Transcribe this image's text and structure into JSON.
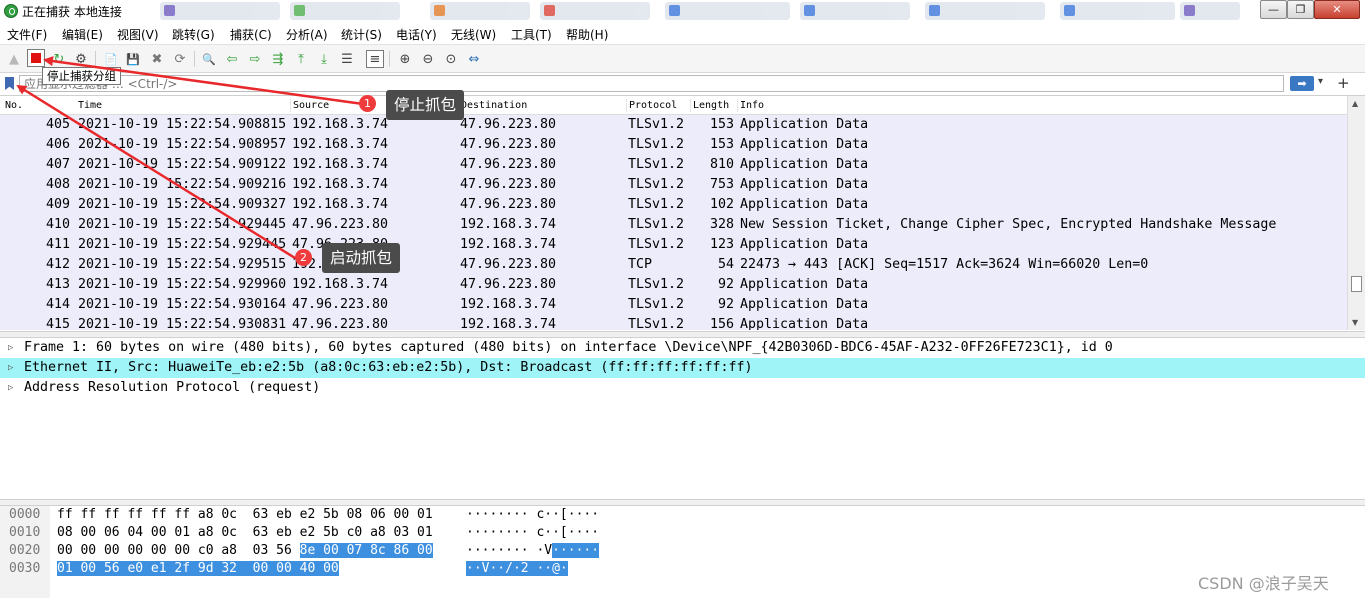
{
  "window": {
    "title": "正在捕获 本地连接",
    "controls": {
      "minimize": "—",
      "maximize": "❐",
      "close": "✕"
    }
  },
  "menu": [
    "文件(F)",
    "编辑(E)",
    "视图(V)",
    "跳转(G)",
    "捕获(C)",
    "分析(A)",
    "统计(S)",
    "电话(Y)",
    "无线(W)",
    "工具(T)",
    "帮助(H)"
  ],
  "toolbar": {
    "tooltip": "停止捕获分组",
    "icons": {
      "start": "▲",
      "stop": "",
      "restart": "↻",
      "options": "⚙",
      "open": "📄",
      "save": "💾",
      "close": "✖",
      "reload": "⟳",
      "find": "🔍",
      "back": "⇦",
      "forward": "⇨",
      "goto": "⇶",
      "first": "⤒",
      "last": "⤓",
      "autoscroll": "☰",
      "colorize": "≡",
      "zoom_in": "⊕",
      "zoom_out": "⊖",
      "zoom_reset": "⊙",
      "resize_columns": "⇔"
    }
  },
  "filter": {
    "placeholder": "应用显示过滤器 … <Ctrl-/>",
    "apply": "➡",
    "dropdown": "▾",
    "add": "+"
  },
  "packet_list": {
    "columns": [
      "No.",
      "Time",
      "Source",
      "Destination",
      "Protocol",
      "Length",
      "Info"
    ],
    "rows": [
      [
        "405",
        "2021-10-19 15:22:54.908815",
        "192.168.3.74",
        "47.96.223.80",
        "TLSv1.2",
        "153",
        "Application Data"
      ],
      [
        "406",
        "2021-10-19 15:22:54.908957",
        "192.168.3.74",
        "47.96.223.80",
        "TLSv1.2",
        "153",
        "Application Data"
      ],
      [
        "407",
        "2021-10-19 15:22:54.909122",
        "192.168.3.74",
        "47.96.223.80",
        "TLSv1.2",
        "810",
        "Application Data"
      ],
      [
        "408",
        "2021-10-19 15:22:54.909216",
        "192.168.3.74",
        "47.96.223.80",
        "TLSv1.2",
        "753",
        "Application Data"
      ],
      [
        "409",
        "2021-10-19 15:22:54.909327",
        "192.168.3.74",
        "47.96.223.80",
        "TLSv1.2",
        "102",
        "Application Data"
      ],
      [
        "410",
        "2021-10-19 15:22:54.929445",
        "47.96.223.80",
        "192.168.3.74",
        "TLSv1.2",
        "328",
        "New Session Ticket, Change Cipher Spec, Encrypted Handshake Message"
      ],
      [
        "411",
        "2021-10-19 15:22:54.929445",
        "47.96.223.80",
        "192.168.3.74",
        "TLSv1.2",
        "123",
        "Application Data"
      ],
      [
        "412",
        "2021-10-19 15:22:54.929515",
        "192.168.3.74",
        "47.96.223.80",
        "TCP",
        "54",
        "22473 → 443 [ACK] Seq=1517 Ack=3624 Win=66020 Len=0"
      ],
      [
        "413",
        "2021-10-19 15:22:54.929960",
        "192.168.3.74",
        "47.96.223.80",
        "TLSv1.2",
        "92",
        "Application Data"
      ],
      [
        "414",
        "2021-10-19 15:22:54.930164",
        "47.96.223.80",
        "192.168.3.74",
        "TLSv1.2",
        "92",
        "Application Data"
      ],
      [
        "415",
        "2021-10-19 15:22:54.930831",
        "47.96.223.80",
        "192.168.3.74",
        "TLSv1.2",
        "156",
        "Application Data"
      ]
    ]
  },
  "details": [
    "Frame 1: 60 bytes on wire (480 bits), 60 bytes captured (480 bits) on interface \\Device\\NPF_{42B0306D-BDC6-45AF-A232-0FF26FE723C1}, id 0",
    "Ethernet II, Src: HuaweiTe_eb:e2:5b (a8:0c:63:eb:e2:5b), Dst: Broadcast (ff:ff:ff:ff:ff:ff)",
    "Address Resolution Protocol (request)"
  ],
  "bytes": [
    {
      "offset": "0000",
      "hex_a": "ff ff ff ff ff ff a8 0c  63 eb e2 5b 08 06 00 01",
      "hex_b": "",
      "ascii_a": "········ c··[····",
      "ascii_b": ""
    },
    {
      "offset": "0010",
      "hex_a": "08 00 06 04 00 01 a8 0c  63 eb e2 5b c0 a8 03 01",
      "hex_b": "",
      "ascii_a": "········ c··[····",
      "ascii_b": ""
    },
    {
      "offset": "0020",
      "hex_a": "00 00 00 00 00 00 c0 a8  03 56 ",
      "hex_b": "8e 00 07 8c 86 00",
      "ascii_a": "········ ·V",
      "ascii_b": "······"
    },
    {
      "offset": "0030",
      "hex_a": "",
      "hex_b": "01 00 56 e0 e1 2f 9d 32  00 00 40 00",
      "ascii_a": "",
      "ascii_b": "··V··/·2 ··@·"
    }
  ],
  "annotations": {
    "one": {
      "number": "1",
      "label": "停止抓包"
    },
    "two": {
      "number": "2",
      "label": "启动抓包"
    }
  },
  "watermark": "CSDN @浪子吴天",
  "colors": {
    "row_bg": "#ececfb",
    "detail_highlight": "#9ef4f6",
    "byte_highlight": "#3d8fe0",
    "arrow": "#e8282b"
  }
}
